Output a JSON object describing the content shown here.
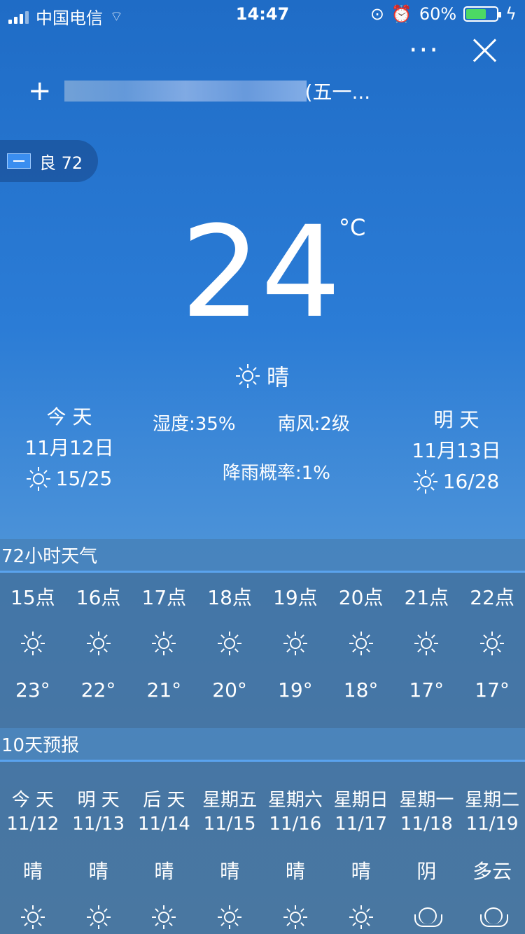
{
  "status": {
    "carrier": "中国电信",
    "time": "14:47",
    "battery": "60%"
  },
  "header": {
    "location_suffix": "(五一..."
  },
  "aqi": {
    "text": "良 72"
  },
  "current": {
    "temp": "24",
    "unit": "°C",
    "condition": "晴"
  },
  "today": {
    "label": "今 天",
    "date": "11月12日",
    "range": "15/25"
  },
  "tomorrow": {
    "label": "明 天",
    "date": "11月13日",
    "range": "16/28"
  },
  "details": {
    "humidity": "湿度:35%",
    "wind": "南风:2级",
    "rain": "降雨概率:1%"
  },
  "hourly": {
    "title": "72小时天气",
    "items": [
      {
        "hour": "15点",
        "icon": "sun-icon",
        "temp": "23°"
      },
      {
        "hour": "16点",
        "icon": "sun-icon",
        "temp": "22°"
      },
      {
        "hour": "17点",
        "icon": "sun-icon",
        "temp": "21°"
      },
      {
        "hour": "18点",
        "icon": "sun-icon",
        "temp": "20°"
      },
      {
        "hour": "19点",
        "icon": "sun-icon",
        "temp": "19°"
      },
      {
        "hour": "20点",
        "icon": "sun-icon",
        "temp": "18°"
      },
      {
        "hour": "21点",
        "icon": "sun-icon",
        "temp": "17°"
      },
      {
        "hour": "22点",
        "icon": "sun-icon",
        "temp": "17°"
      }
    ]
  },
  "forecast": {
    "title": "10天预报",
    "items": [
      {
        "day": "今 天",
        "date": "11/12",
        "cond": "晴",
        "icon": "sun-icon"
      },
      {
        "day": "明 天",
        "date": "11/13",
        "cond": "晴",
        "icon": "sun-icon"
      },
      {
        "day": "后 天",
        "date": "11/14",
        "cond": "晴",
        "icon": "sun-icon"
      },
      {
        "day": "星期五",
        "date": "11/15",
        "cond": "晴",
        "icon": "sun-icon"
      },
      {
        "day": "星期六",
        "date": "11/16",
        "cond": "晴",
        "icon": "sun-icon"
      },
      {
        "day": "星期日",
        "date": "11/17",
        "cond": "晴",
        "icon": "sun-icon"
      },
      {
        "day": "星期一",
        "date": "11/18",
        "cond": "阴",
        "icon": "cloud-icon"
      },
      {
        "day": "星期二",
        "date": "11/19",
        "cond": "多云",
        "icon": "cloud-icon"
      }
    ]
  }
}
